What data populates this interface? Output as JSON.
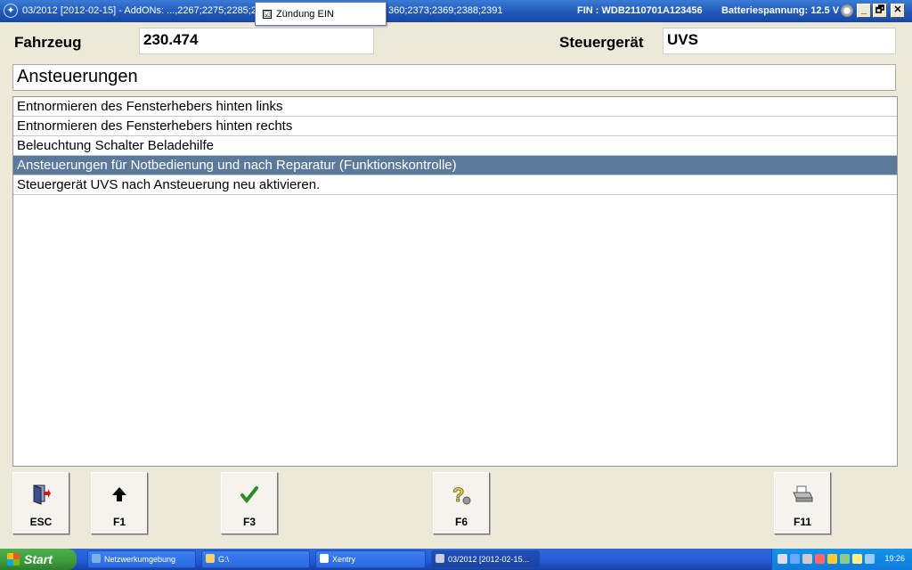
{
  "window": {
    "title": "03/2012 [2012-02-15] - AddONs: ...,2267;2275;2285;2",
    "title_cont": "360;2373;2369;2388;2391",
    "fin": "FIN : WDB2110701A123456",
    "battery": "Batteriespannung: 12.5 V",
    "popup_label": "Zündung EIN",
    "popup_checked": "☑",
    "buttons": {
      "minimize": "_",
      "restore": "🗗",
      "close": "✕"
    }
  },
  "info": {
    "vehicle_label": "Fahrzeug",
    "vehicle_value": "230.474",
    "ecu_label": "Steuergerät",
    "ecu_value": "UVS"
  },
  "section_title": "Ansteuerungen",
  "list": {
    "selected_index": 3,
    "items": [
      "Entnormieren des Fensterhebers hinten links",
      "Entnormieren des Fensterhebers hinten rechts",
      "Beleuchtung Schalter Beladehilfe",
      "Ansteuerungen für Notbedienung und nach Reparatur (Funktionskontrolle)",
      "Steuergerät UVS nach Ansteuerung neu aktivieren."
    ]
  },
  "function_keys": [
    {
      "key": "ESC",
      "icon": "exit-door-icon"
    },
    {
      "key": "F1",
      "icon": "arrow-up-icon"
    },
    {
      "key": "F3",
      "icon": "check-mark-icon"
    },
    {
      "key": "F6",
      "icon": "help-question-icon"
    },
    {
      "key": "F11",
      "icon": "printer-icon"
    }
  ],
  "taskbar": {
    "start_label": "Start",
    "tasks": [
      {
        "label": "Netzwerkumgebung",
        "icon": "network-icon"
      },
      {
        "label": "G:\\",
        "icon": "folder-icon"
      },
      {
        "label": "Xentry",
        "icon": "xentry-icon"
      },
      {
        "label": "03/2012 [2012-02-15...",
        "icon": "mercedes-icon"
      }
    ],
    "clock": "19:26"
  },
  "colors": {
    "selection": "#5B799A",
    "titlebar": "#1E56B8",
    "start_green": "#3C9B3C"
  }
}
